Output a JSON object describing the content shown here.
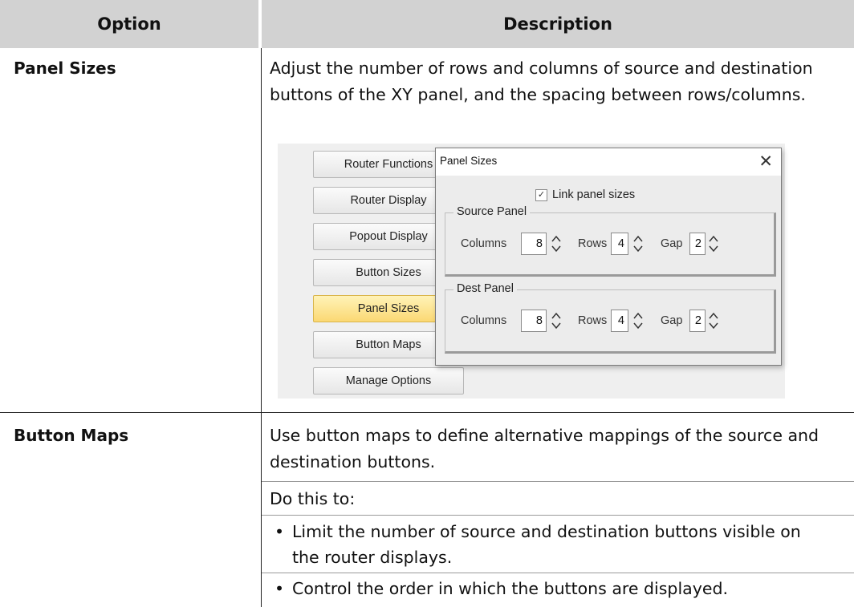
{
  "table": {
    "header": {
      "option": "Option",
      "description": "Description"
    },
    "rows": [
      {
        "option": "Panel Sizes",
        "description_lines": [
          "Adjust the number of rows and columns of source and destination",
          "buttons of the XY panel, and the spacing between rows/columns."
        ]
      },
      {
        "option": "Button Maps",
        "description_lines": [
          "Use button maps to define alternative mappings of the source and",
          "destination buttons."
        ],
        "intro": "Do this to:",
        "bullets": [
          {
            "lines": [
              "Limit the number of source and destination buttons visible on",
              "the router displays."
            ]
          },
          {
            "lines": [
              "Control the order in which the buttons are displayed."
            ]
          }
        ]
      }
    ]
  },
  "screenshot": {
    "side_buttons": [
      {
        "label": "Router Functions",
        "active": false
      },
      {
        "label": "Router Display",
        "active": false
      },
      {
        "label": "Popout Display",
        "active": false
      },
      {
        "label": "Button Sizes",
        "active": false
      },
      {
        "label": "Panel Sizes",
        "active": true
      },
      {
        "label": "Button Maps",
        "active": false
      },
      {
        "label": "Manage Options",
        "active": false
      }
    ],
    "dialog": {
      "title": "Panel Sizes",
      "close_glyph": "✕",
      "link_checkbox": {
        "label": "Link panel sizes",
        "checked": true,
        "check_glyph": "✓"
      },
      "groups": [
        {
          "title": "Source Panel",
          "columns_label": "Columns",
          "columns_value": "8",
          "rows_label": "Rows",
          "rows_value": "4",
          "gap_label": "Gap",
          "gap_value": "2"
        },
        {
          "title": "Dest Panel",
          "columns_label": "Columns",
          "columns_value": "8",
          "rows_label": "Rows",
          "rows_value": "4",
          "gap_label": "Gap",
          "gap_value": "2"
        }
      ]
    }
  },
  "colors": {
    "header_bg": "#d2d2d2",
    "active_button": "#fbd873",
    "screenshot_bg": "#efefef"
  }
}
